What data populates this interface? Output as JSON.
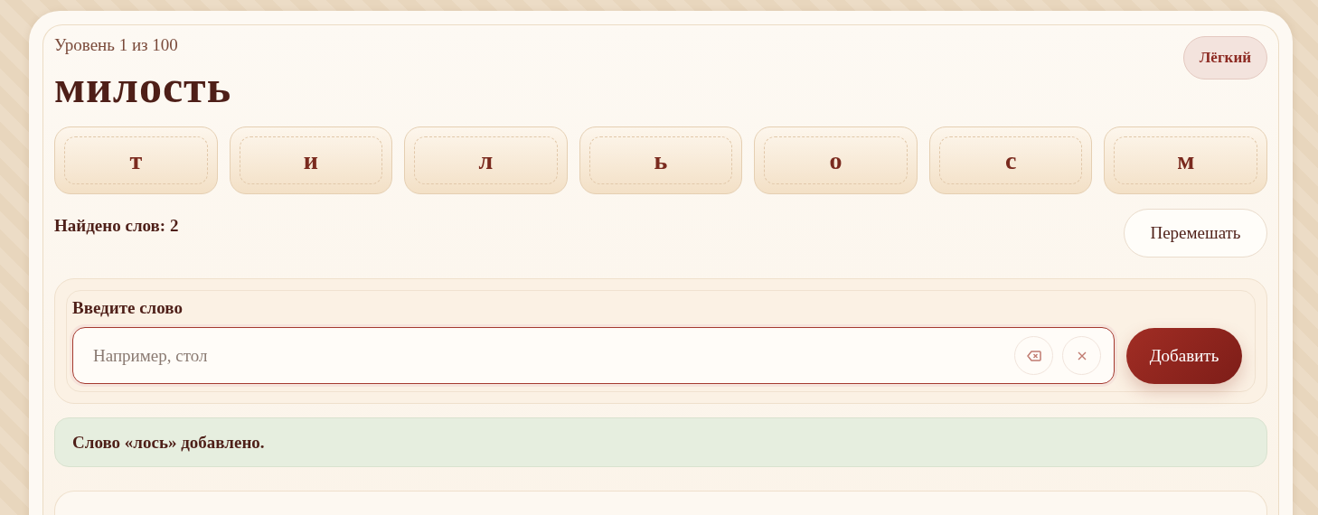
{
  "level_label": "Уровень 1 из 100",
  "difficulty": "Лёгкий",
  "word": "милость",
  "letters": [
    "т",
    "и",
    "л",
    "ь",
    "о",
    "с",
    "м"
  ],
  "found_count": "Найдено слов: 2",
  "shuffle_button": "Перемешать",
  "input": {
    "label": "Введите слово",
    "placeholder": "Например, стол"
  },
  "add_button": "Добавить",
  "message": "Слово «лось» добавлено."
}
